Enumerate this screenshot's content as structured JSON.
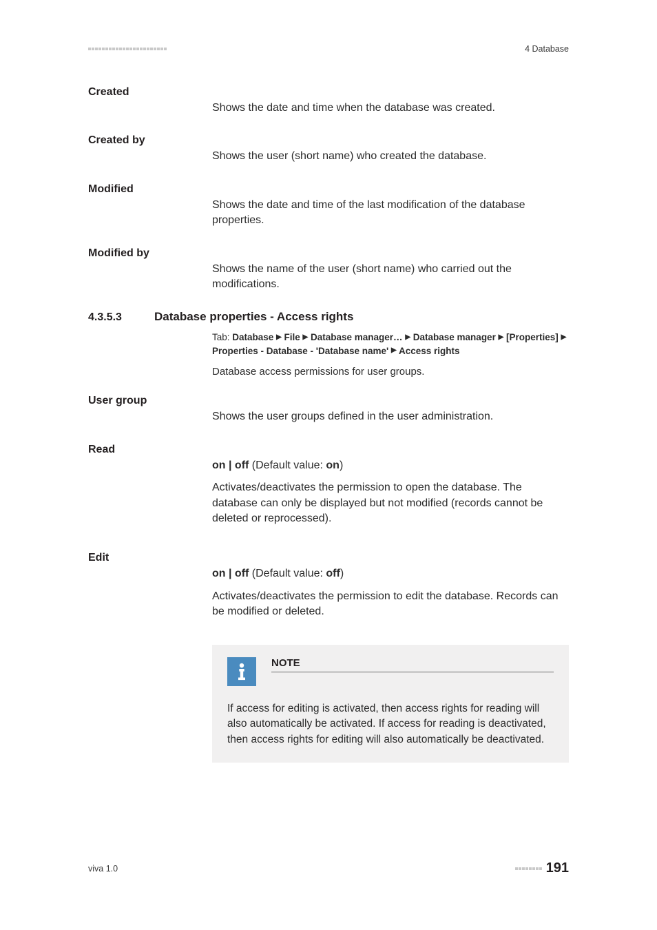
{
  "header": {
    "section": "4 Database"
  },
  "defs": [
    {
      "term": "Created",
      "body": "Shows the date and time when the database was created."
    },
    {
      "term": "Created by",
      "body": "Shows the user (short name) who created the database."
    },
    {
      "term": "Modified",
      "body": "Shows the date and time of the last modification of the database properties."
    },
    {
      "term": "Modified by",
      "body": "Shows the name of the user (short name) who carried out the modifications."
    }
  ],
  "subsection": {
    "number": "4.3.5.3",
    "title": "Database properties - Access rights",
    "tab_prefix": "Tab: ",
    "tab_path": "Database ▸ File ▸ Database manager… ▸ Database manager ▸ [Properties] ▸ Properties - Database - 'Database name' ▸ Access rights",
    "intro": "Database access permissions for user groups."
  },
  "defs2": [
    {
      "term": "User group",
      "body": "Shows the user groups defined in the user administration."
    }
  ],
  "read": {
    "term": "Read",
    "onoff_prefix": "on | off",
    "onoff_paren_open": " (Default value: ",
    "onoff_default": "on",
    "onoff_paren_close": ")",
    "body": "Activates/deactivates the permission to open the database. The database can only be displayed but not modified (records cannot be deleted or reprocessed)."
  },
  "edit": {
    "term": "Edit",
    "onoff_prefix": "on | off",
    "onoff_paren_open": " (Default value: ",
    "onoff_default": "off",
    "onoff_paren_close": ")",
    "body": "Activates/deactivates the permission to edit the database. Records can be modified or deleted."
  },
  "note": {
    "title": "NOTE",
    "text": "If access for editing is activated, then access rights for reading will also automatically be activated. If access for reading is deactivated, then access rights for editing will also automatically be deactivated."
  },
  "footer": {
    "product": "viva 1.0",
    "page": "191"
  }
}
